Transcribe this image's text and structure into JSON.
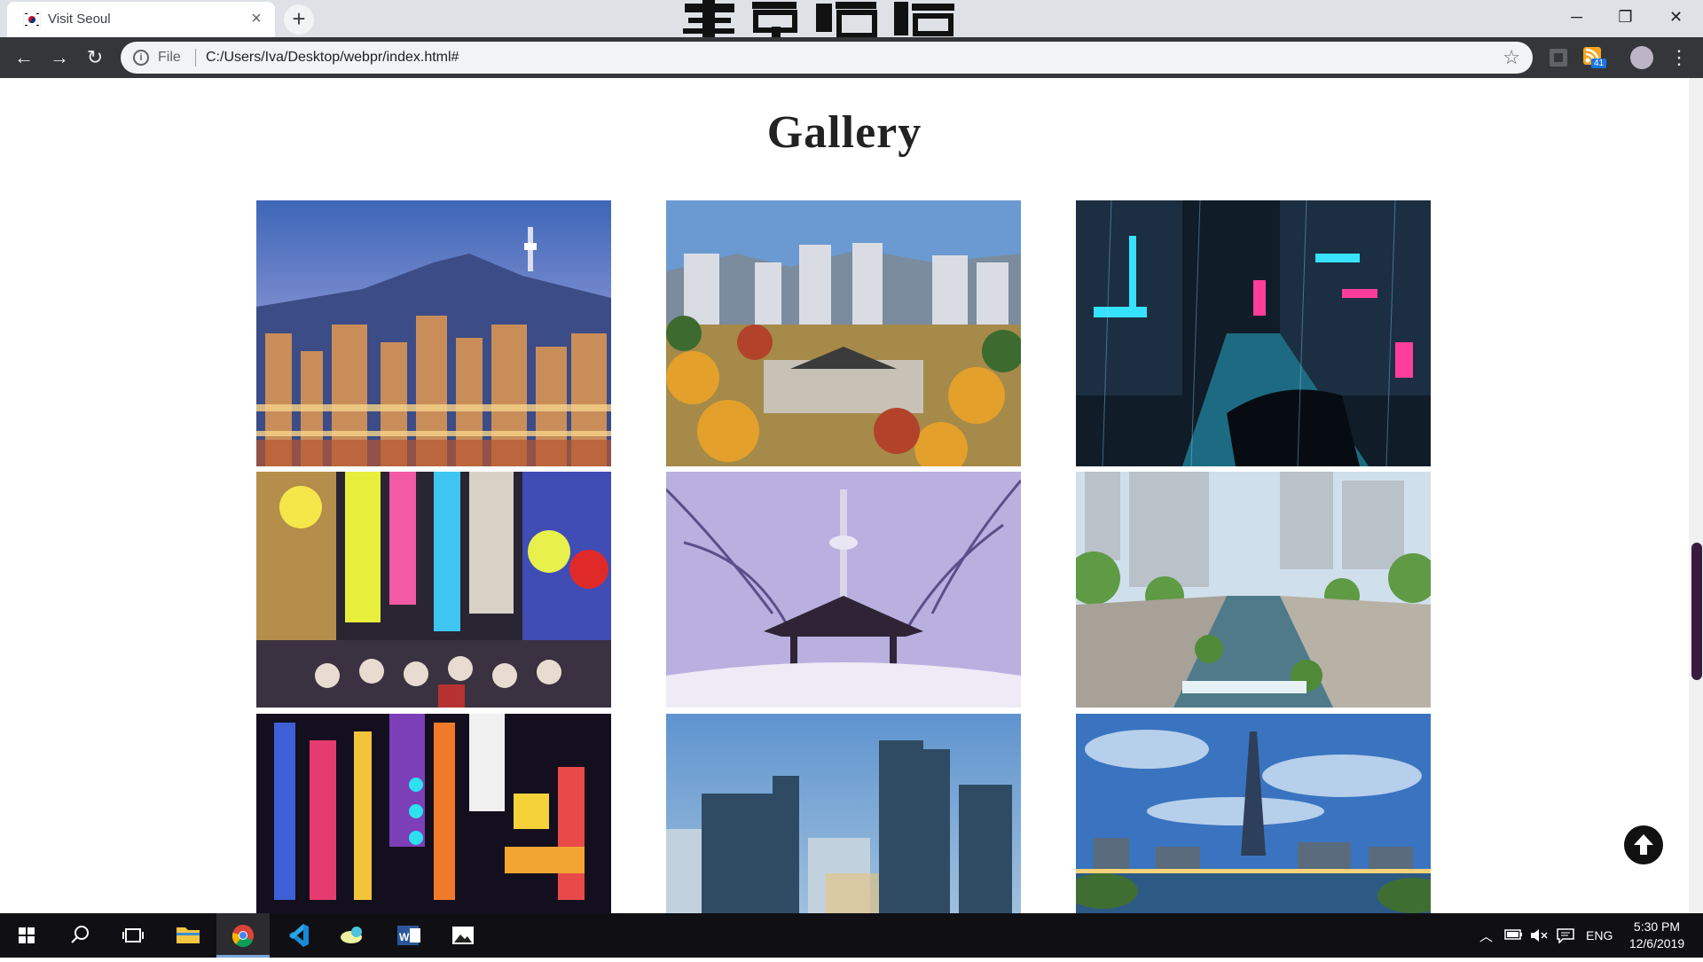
{
  "browser": {
    "tab_title": "Visit Seoul",
    "tab_close": "×",
    "new_tab": "+",
    "window_controls": {
      "minimize": "─",
      "restore": "❐",
      "close": "✕"
    },
    "nav": {
      "back": "←",
      "forward": "→",
      "reload": "↻"
    },
    "address": {
      "scheme_label": "File",
      "url": "C:/Users/Iva/Desktop/webpr/index.html#"
    },
    "extension_badge": "41",
    "menu": "⋮"
  },
  "page": {
    "heading": "Gallery",
    "images": [
      {
        "name": "namsan-tower-skyline-night"
      },
      {
        "name": "gyeongbokgung-palace-autumn"
      },
      {
        "name": "neon-street-rain-night"
      },
      {
        "name": "myeongdong-shopping-street"
      },
      {
        "name": "namsan-tower-snow-pavilion"
      },
      {
        "name": "cheonggyecheon-stream"
      },
      {
        "name": "neon-signs-alley"
      },
      {
        "name": "gangnam-office-towers"
      },
      {
        "name": "lotte-world-tower-lake"
      }
    ]
  },
  "taskbar": {
    "language": "ENG",
    "time": "5:30 PM",
    "date": "12/6/2019"
  },
  "colors": {
    "tab_bar": "#dee1e6",
    "toolbar": "#35363a",
    "omnibox": "#f1f3f4",
    "taskbar": "#101014",
    "scroll_thumb": "#3a1c41"
  }
}
